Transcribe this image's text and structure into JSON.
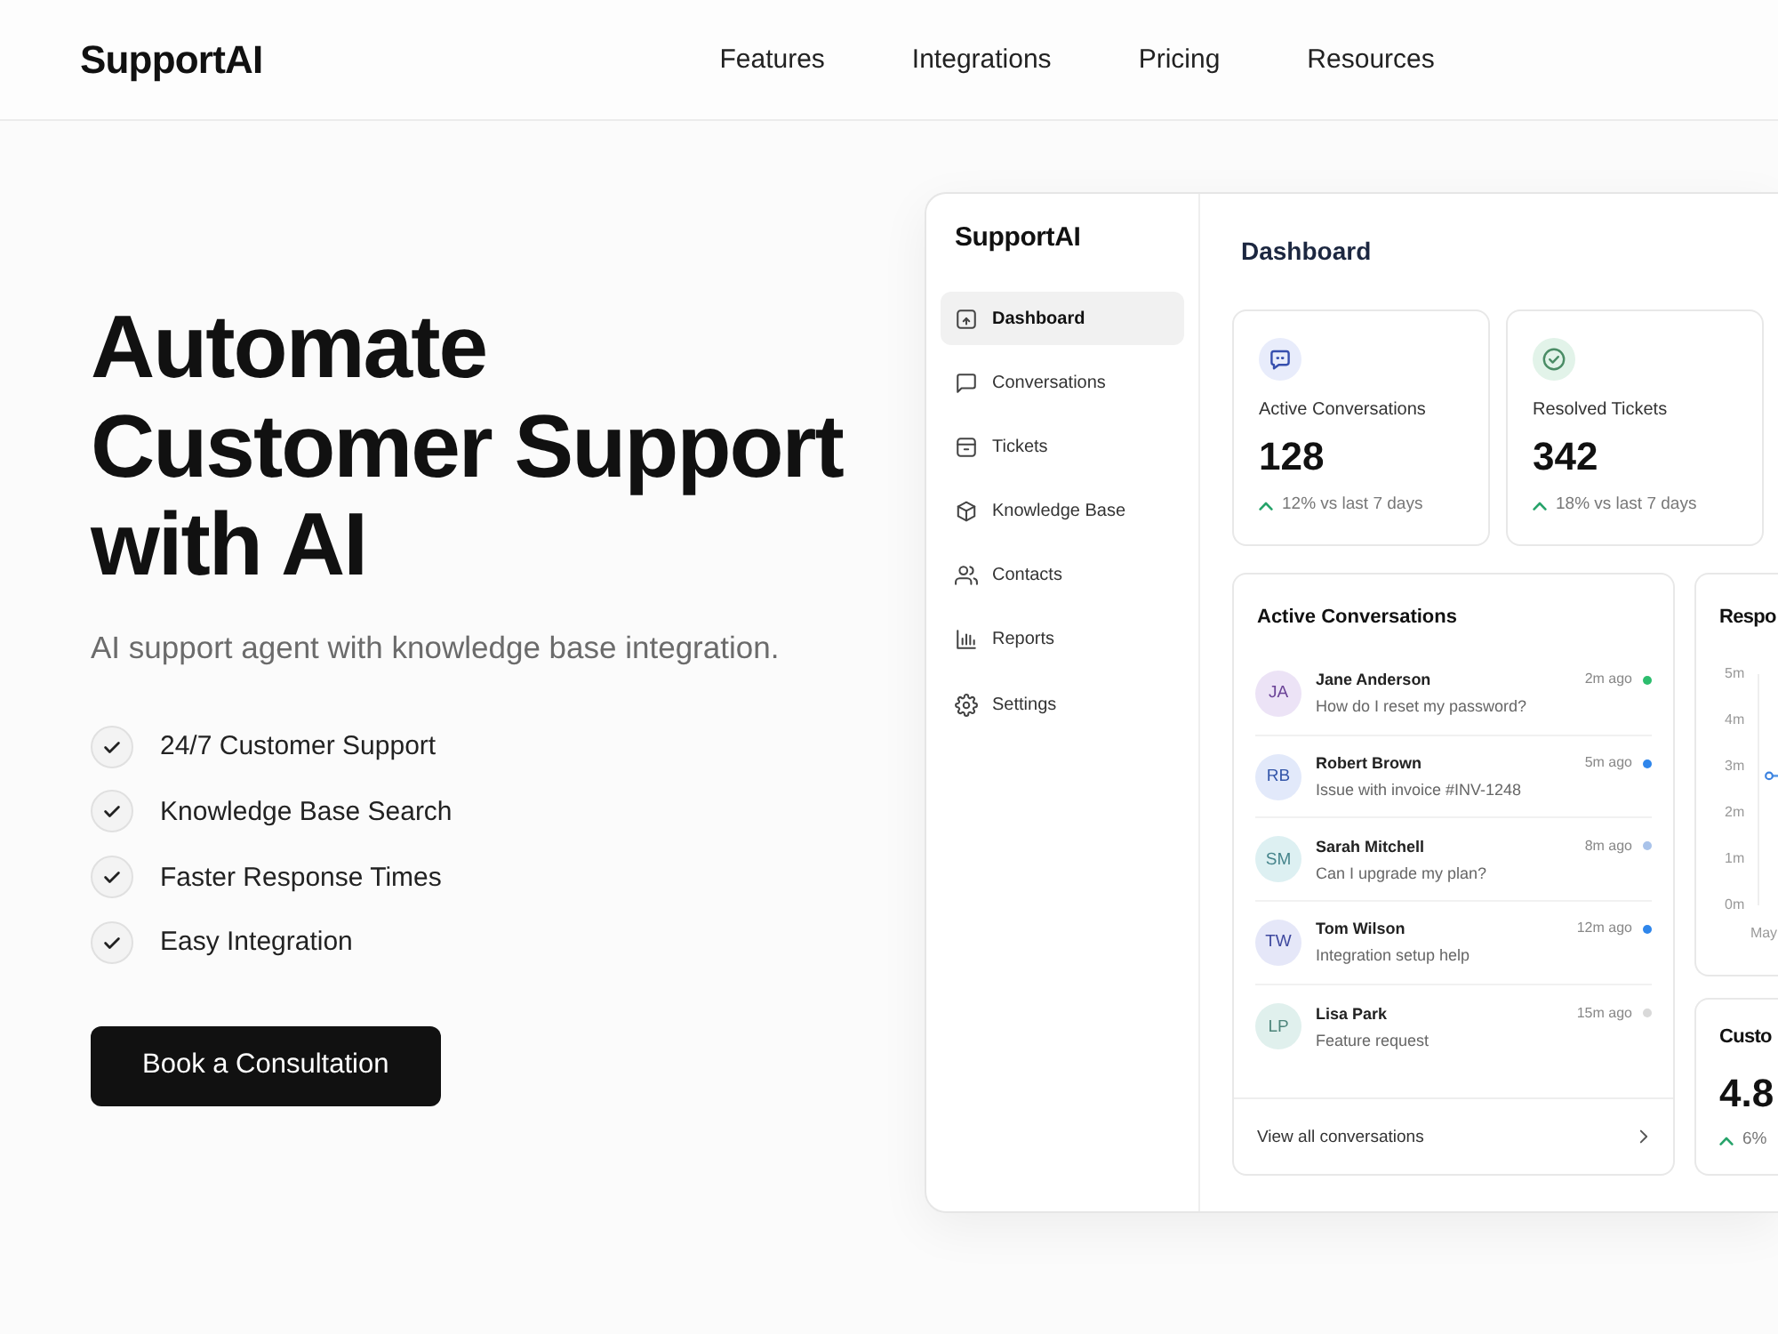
{
  "header": {
    "logo": "SupportAI",
    "nav": [
      "Features",
      "Integrations",
      "Pricing",
      "Resources"
    ]
  },
  "hero": {
    "title": "Automate Customer Support with AI",
    "subtitle": "AI support agent with knowledge base integration.",
    "features": [
      "24/7 Customer Support",
      "Knowledge Base Search",
      "Faster Response Times",
      "Easy Integration"
    ],
    "cta": "Book a Consultation"
  },
  "dashboard": {
    "logo": "SupportAI",
    "sidebar": {
      "items": [
        {
          "label": "Dashboard",
          "selected": true
        },
        {
          "label": "Conversations",
          "selected": false
        },
        {
          "label": "Tickets",
          "selected": false
        },
        {
          "label": "Knowledge Base",
          "selected": false
        },
        {
          "label": "Contacts",
          "selected": false
        },
        {
          "label": "Reports",
          "selected": false
        },
        {
          "label": "Settings",
          "selected": false
        }
      ]
    },
    "title": "Dashboard",
    "stats": [
      {
        "label": "Active Conversations",
        "value": "128",
        "trend": "12% vs last 7 days",
        "color": "#e8ecfb"
      },
      {
        "label": "Resolved Tickets",
        "value": "342",
        "trend": "18% vs last 7 days",
        "color": "#e2f3e9"
      }
    ],
    "conversations": {
      "title": "Active Conversations",
      "items": [
        {
          "avatar": {
            "initials": "JA",
            "color": "#ece3f6"
          },
          "name": "Jane Anderson",
          "message": "How do I reset my password?",
          "time": "2m ago",
          "color": "#2dbd6e"
        },
        {
          "avatar": {
            "initials": "RB",
            "color": "#e2e9fa"
          },
          "name": "Robert Brown",
          "message": "Issue with invoice #INV-1248",
          "time": "5m ago",
          "color": "#2f86eb"
        },
        {
          "avatar": {
            "initials": "SM",
            "color": "#ddf0f2"
          },
          "name": "Sarah Mitchell",
          "message": "Can I upgrade my plan?",
          "time": "8m ago",
          "color": "#a9c3ea"
        },
        {
          "avatar": {
            "initials": "TW",
            "color": "#e5e7f8"
          },
          "name": "Tom Wilson",
          "message": "Integration setup help",
          "time": "12m ago",
          "color": "#2f86eb"
        },
        {
          "avatar": {
            "initials": "LP",
            "color": "#e0f0ed"
          },
          "name": "Lisa Park",
          "message": "Feature request",
          "time": "15m ago",
          "color": "#d9d9d9"
        }
      ],
      "footer": "View all conversations"
    },
    "chart_card": {
      "title": "Respo",
      "chart_data": {
        "type": "line",
        "marker": true,
        "categories": [
          "May"
        ],
        "values": [
          2.8
        ],
        "ylim": [
          0,
          5
        ],
        "yticks": [
          {
            "value": 0,
            "label": "0m"
          },
          {
            "value": 1,
            "label": "1m"
          },
          {
            "value": 2,
            "label": "2m"
          },
          {
            "value": 3,
            "label": "3m"
          },
          {
            "value": 4,
            "label": "4m"
          },
          {
            "value": 5,
            "label": "5m"
          }
        ]
      }
    },
    "metric_card": {
      "title": "Custo",
      "value": "4.8",
      "trend": "6%"
    }
  }
}
